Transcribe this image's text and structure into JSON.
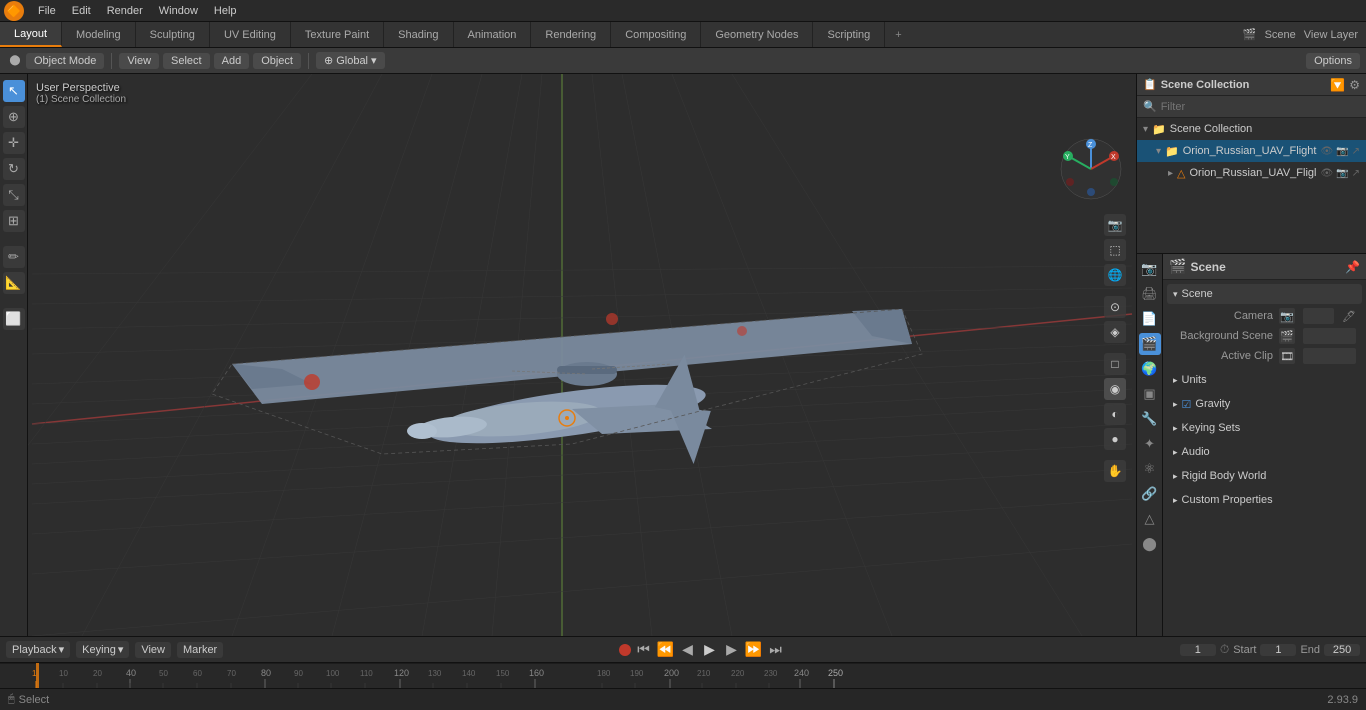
{
  "app": {
    "title": "Blender",
    "version": "2.93.9"
  },
  "top_menu": {
    "items": [
      "File",
      "Edit",
      "Render",
      "Window",
      "Help"
    ]
  },
  "workspace_tabs": {
    "items": [
      "Layout",
      "Modeling",
      "Sculpting",
      "UV Editing",
      "Texture Paint",
      "Shading",
      "Animation",
      "Rendering",
      "Compositing",
      "Geometry Nodes",
      "Scripting"
    ],
    "active": "Layout",
    "right": {
      "scene_icon": "🎬",
      "scene_name": "Scene",
      "view_layer": "View Layer"
    }
  },
  "tool_header": {
    "mode": "Object Mode",
    "transform": "Global",
    "view_label": "View",
    "select_label": "Select",
    "add_label": "Add",
    "object_label": "Object",
    "options_label": "Options"
  },
  "viewport": {
    "perspective_label": "User Perspective",
    "collection_label": "(1) Scene Collection"
  },
  "outliner": {
    "title": "Scene Collection",
    "search_placeholder": "Filter",
    "items": [
      {
        "name": "Orion_Russian_UAV_Flight",
        "type": "scene",
        "indent": 0,
        "expanded": true
      },
      {
        "name": "Orion_Russian_UAV_Fligl",
        "type": "mesh",
        "indent": 1,
        "expanded": false
      }
    ]
  },
  "properties": {
    "scene_title": "Scene",
    "section_scene": "Scene",
    "camera_label": "Camera",
    "background_scene_label": "Background Scene",
    "active_clip_label": "Active Clip",
    "section_units": "Units",
    "section_gravity": "Gravity",
    "gravity_checkbox": true,
    "section_keying_sets": "Keying Sets",
    "section_audio": "Audio",
    "section_rigid_body_world": "Rigid Body World",
    "section_custom_properties": "Custom Properties"
  },
  "timeline": {
    "playback_label": "Playback",
    "keying_label": "Keying",
    "view_label": "View",
    "marker_label": "Marker",
    "frame_current": "1",
    "start_label": "Start",
    "start_value": "1",
    "end_label": "End",
    "end_value": "250"
  },
  "ruler": {
    "marks": [
      1,
      40,
      80,
      120,
      160,
      200,
      250
    ]
  },
  "status_bar": {
    "left": "Select",
    "right": "2.93.9",
    "select_icon": "🖱"
  },
  "colors": {
    "accent": "#e87d0d",
    "active_tab_bg": "#3c3c3c",
    "selected_item": "#1a5276",
    "panel_bg": "#2e2e2e",
    "header_bg": "#3a3a3a"
  }
}
